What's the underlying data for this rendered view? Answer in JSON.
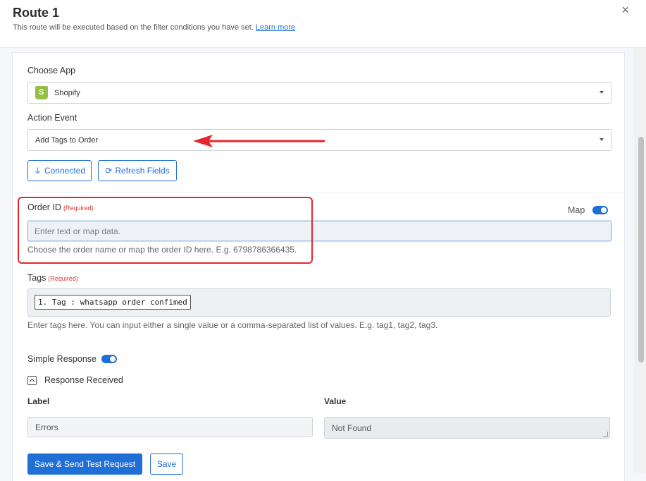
{
  "header": {
    "title": "Route 1",
    "subtitle": "This route will be executed based on the filter conditions you have set.",
    "learn_more": "Learn more",
    "close_glyph": "×"
  },
  "form": {
    "choose_app_label": "Choose App",
    "app_value": "Shopify",
    "action_event_label": "Action Event",
    "action_value": "Add Tags to Order",
    "connected_label": "Connected",
    "refresh_label": "Refresh Fields",
    "order_id": {
      "label": "Order ID",
      "required": "(Required)",
      "map_label": "Map",
      "placeholder": "Enter text or map data.",
      "help": "Choose the order name or map the order ID here. E.g. 6798786366435."
    },
    "tags": {
      "label": "Tags",
      "required": "(Required)",
      "chip": "1. Tag : whatsapp order confimed",
      "help": "Enter tags here. You can input either a single value or a comma-separated list of values. E.g. tag1, tag2, tag3."
    },
    "simple_response_label": "Simple Response",
    "response_received_label": "Response Received",
    "table": {
      "label_header": "Label",
      "value_header": "Value",
      "label_value": "Errors",
      "value_value": "Not Found"
    },
    "save_send_label": "Save & Send Test Request",
    "save_label": "Save"
  },
  "colors": {
    "accent": "#1f6fd6",
    "annotation": "#e8262a",
    "shopify": "#95bf47"
  }
}
